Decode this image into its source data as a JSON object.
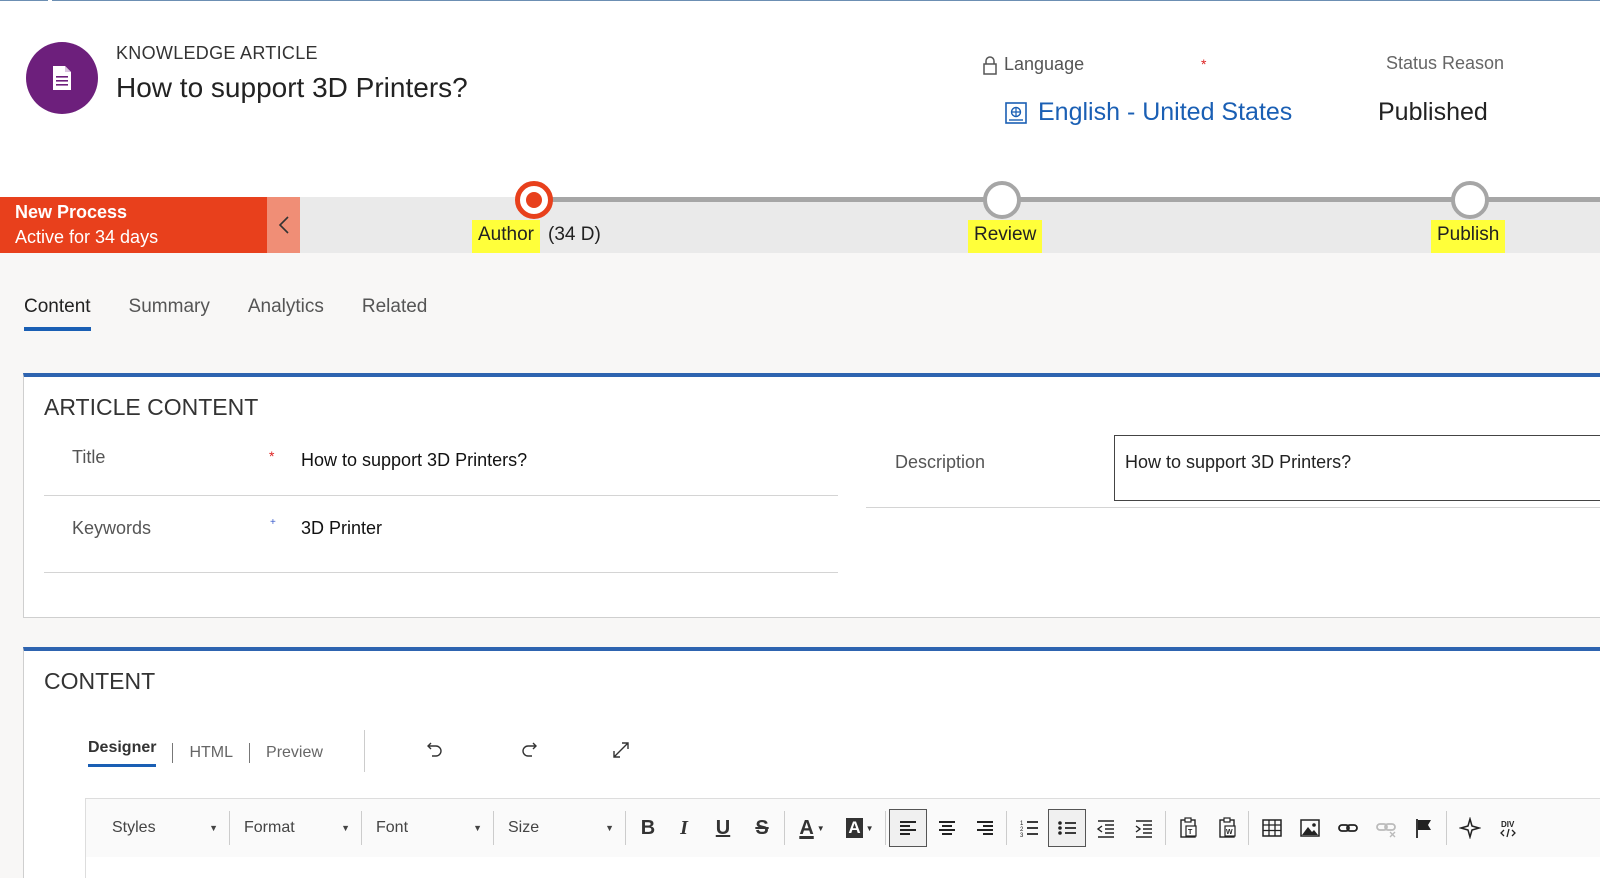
{
  "header": {
    "entity_type": "KNOWLEDGE ARTICLE",
    "record_title": "How to support 3D Printers?",
    "avatar_icon": "document-icon",
    "language_label": "Language",
    "language_required_mark": "*",
    "language_value": "English - United States",
    "status_label": "Status Reason",
    "status_value": "Published"
  },
  "process": {
    "name": "New Process",
    "active_text": "Active for 34 days",
    "stages": [
      {
        "label": "Author",
        "duration": "(34 D)",
        "state": "active"
      },
      {
        "label": "Review",
        "duration": "",
        "state": "inactive"
      },
      {
        "label": "Publish",
        "duration": "",
        "state": "inactive"
      }
    ],
    "highlight_color": "#ffff3a",
    "accent_color": "#e8401c"
  },
  "tabs": [
    {
      "label": "Content",
      "active": true
    },
    {
      "label": "Summary",
      "active": false
    },
    {
      "label": "Analytics",
      "active": false
    },
    {
      "label": "Related",
      "active": false
    }
  ],
  "article_content": {
    "section_title": "ARTICLE CONTENT",
    "title_label": "Title",
    "title_required_mark": "*",
    "title_value": "How to support 3D Printers?",
    "keywords_label": "Keywords",
    "keywords_recommended_mark": "+",
    "keywords_value": "3D Printer",
    "description_label": "Description",
    "description_value": "How to support 3D Printers?"
  },
  "content": {
    "section_title": "CONTENT",
    "editor_tabs": [
      {
        "label": "Designer",
        "active": true
      },
      {
        "label": "HTML",
        "active": false
      },
      {
        "label": "Preview",
        "active": false
      }
    ],
    "toolbar": {
      "styles": "Styles",
      "format": "Format",
      "font": "Font",
      "size": "Size",
      "bold": "B",
      "italic": "I",
      "underline": "U",
      "strike": "S",
      "font_color": "A",
      "bg_color": "A"
    }
  }
}
